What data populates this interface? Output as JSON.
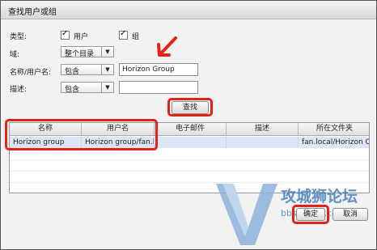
{
  "window": {
    "title": "查找用户或组"
  },
  "form": {
    "type_label": "类型:",
    "user_check_label": "用户",
    "group_check_label": "组",
    "domain_label": "域:",
    "domain_value": "整个目录",
    "name_label": "名称/用户名:",
    "name_op": "包含",
    "name_value": "Horizon Group",
    "desc_label": "描述:",
    "desc_op": "包含",
    "desc_value": "",
    "search_button": "查找"
  },
  "table": {
    "columns": [
      "名称",
      "用户名",
      "电子邮件",
      "描述",
      "所在文件夹"
    ],
    "rows": [
      [
        "Horizon group",
        "Horizon group/fan.l",
        "",
        "",
        "fan.local/Horizon OU"
      ]
    ]
  },
  "footer": {
    "ok_button": "确定",
    "cancel_button": "取消"
  },
  "watermark": {
    "brand": "攻城狮论坛",
    "url": "bbs.vlan5.com"
  },
  "colors": {
    "highlight": "#e2231a",
    "selection": "#dbe7f5"
  }
}
